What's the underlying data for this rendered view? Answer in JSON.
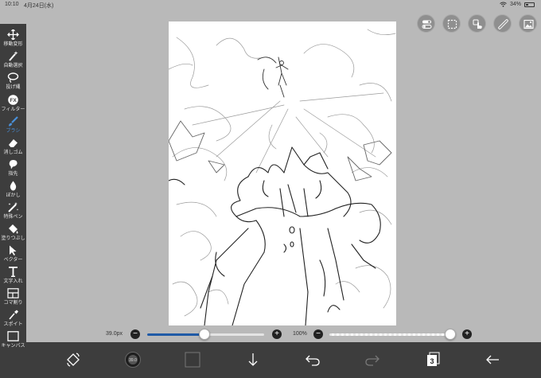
{
  "status_bar": {
    "time": "10:10",
    "date": "4月24日(水)",
    "battery": "34%"
  },
  "tools": [
    {
      "label": "移動変形",
      "icon": "move-icon"
    },
    {
      "label": "自動選択",
      "icon": "magic-wand-icon"
    },
    {
      "label": "投げ縄",
      "icon": "lasso-icon"
    },
    {
      "label": "フィルター",
      "icon": "fx-icon"
    },
    {
      "label": "ブラシ",
      "icon": "brush-icon",
      "active": true
    },
    {
      "label": "消しゴム",
      "icon": "eraser-icon"
    },
    {
      "label": "指先",
      "icon": "finger-icon"
    },
    {
      "label": "ぼかし",
      "icon": "blur-drop-icon"
    },
    {
      "label": "特殊ペン",
      "icon": "special-pen-icon"
    },
    {
      "label": "塗りつぶし",
      "icon": "bucket-icon"
    },
    {
      "label": "ベクター",
      "icon": "vector-icon"
    },
    {
      "label": "文字入れ",
      "icon": "text-icon"
    },
    {
      "label": "コマ割り",
      "icon": "panel-icon"
    },
    {
      "label": "スポイト",
      "icon": "eyedropper-icon"
    },
    {
      "label": "キャンバス",
      "icon": "canvas-icon"
    }
  ],
  "sliders": {
    "brush_size_label": "39.0px",
    "brush_size_fraction": 0.49,
    "opacity_label": "100%",
    "opacity_fraction": 1.0
  },
  "bottom_bar": {
    "layers_count": "3",
    "brush_preview_text": "39.0"
  },
  "colors": {
    "toolbar_bg": "#3d3d3d",
    "workspace_bg": "#b9b9b9",
    "accent": "#4a90d9",
    "current_color": "#3a3a3a"
  }
}
